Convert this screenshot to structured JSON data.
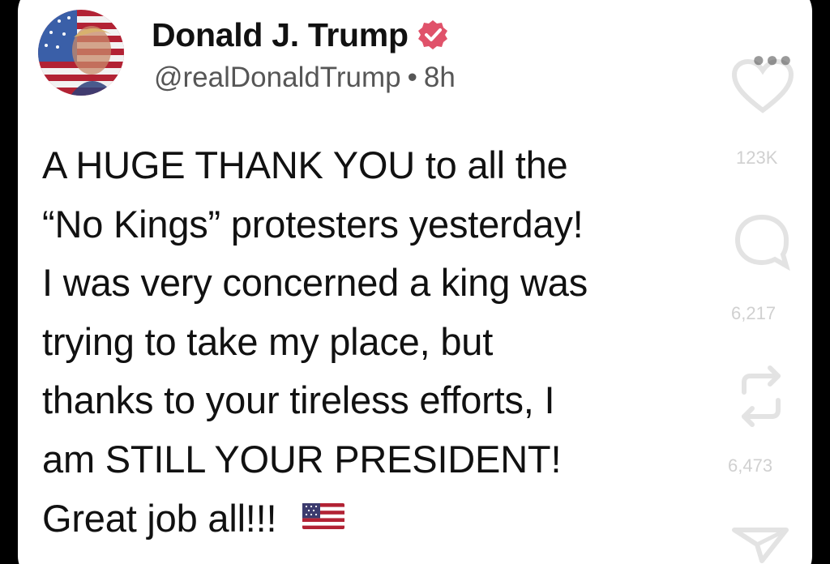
{
  "post": {
    "author_name": "Donald J. Trump",
    "handle": "@realDonaldTrump",
    "separator": "•",
    "time": "8h",
    "text": "A HUGE THANK YOU to all the\n“No Kings” protesters yesterday!\nI was very concerned a king was\ntrying to take my place, but\nthanks to your tireless efforts, I\nam STILL YOUR PRESIDENT!\nGreat job all!!!",
    "flag_icon": "us-flag-emoji",
    "verified_icon": "verified-badge-icon",
    "more_icon": "more-options-icon"
  },
  "actions": {
    "like_count": "123K",
    "comment_count": "6,217",
    "repost_count": "6,473",
    "like_icon": "heart-icon",
    "comment_icon": "comment-icon",
    "repost_icon": "repost-icon",
    "share_icon": "share-icon"
  },
  "colors": {
    "background": "#000000",
    "card": "#ffffff",
    "text": "#111111",
    "secondary_text": "#565656",
    "verified_badge": "#e0526a"
  }
}
